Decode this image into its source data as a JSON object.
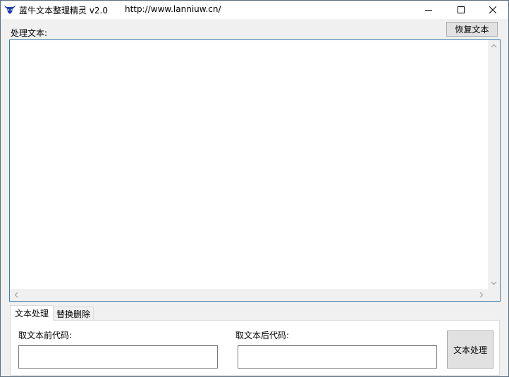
{
  "window": {
    "title": "蓝牛文本整理精灵 v2.0",
    "url": "http://www.lanniuw.cn/"
  },
  "main": {
    "process_label": "处理文本:",
    "restore_button": "恢复文本",
    "text_value": ""
  },
  "tabs": [
    {
      "label": "文本处理",
      "active": true
    },
    {
      "label": "替换删除",
      "active": false
    }
  ],
  "panel": {
    "front_code_label": "取文本前代码:",
    "back_code_label": "取文本后代码:",
    "front_code_value": "",
    "back_code_value": "",
    "process_button": "文本处理"
  },
  "colors": {
    "accent_border": "#3c7fb1",
    "icon_blue": "#1f3fb0"
  },
  "icons": {
    "app": "bull-head-icon",
    "minimize": "minimize-icon",
    "maximize": "maximize-icon",
    "close": "close-icon"
  }
}
